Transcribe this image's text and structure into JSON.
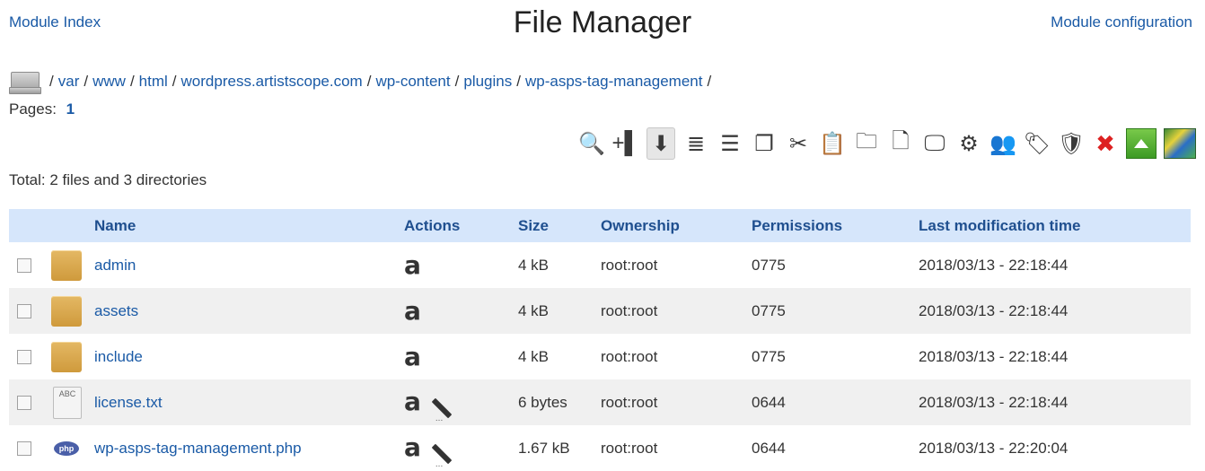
{
  "header": {
    "module_index": "Module Index",
    "title": "File Manager",
    "module_config": "Module configuration"
  },
  "breadcrumb": {
    "root_icon": "drive-icon",
    "leading_sep": "/",
    "items": [
      "var",
      "www",
      "html",
      "wordpress.artistscope.com",
      "wp-content",
      "plugins",
      "wp-asps-tag-management"
    ],
    "trailing_sep": "/"
  },
  "pagination": {
    "label": "Pages:",
    "current": "1"
  },
  "toolbar": [
    {
      "name": "search-icon",
      "glyph": "🔍"
    },
    {
      "name": "add-column-icon",
      "glyph": "+▌"
    },
    {
      "name": "sort-down-icon",
      "glyph": "⬇"
    },
    {
      "name": "list-view-icon",
      "glyph": "≣"
    },
    {
      "name": "detail-list-icon",
      "glyph": "☰"
    },
    {
      "name": "copy-icon",
      "glyph": "❐"
    },
    {
      "name": "cut-icon",
      "glyph": "✂"
    },
    {
      "name": "paste-icon",
      "glyph": "📋"
    },
    {
      "name": "new-folder-icon",
      "glyph": "🗀"
    },
    {
      "name": "new-file-icon",
      "glyph": "🗋"
    },
    {
      "name": "upload-icon",
      "glyph": "🖵"
    },
    {
      "name": "settings-icon",
      "glyph": "⚙"
    },
    {
      "name": "users-icon",
      "glyph": "👥"
    },
    {
      "name": "tag-icon",
      "glyph": "🏷"
    },
    {
      "name": "shield-icon",
      "glyph": "🛡"
    },
    {
      "name": "delete-icon",
      "glyph": "✖"
    },
    {
      "name": "upload-arrow-icon",
      "glyph": ""
    },
    {
      "name": "image-icon",
      "glyph": ""
    }
  ],
  "summary": "Total: 2 files and 3 directories",
  "table": {
    "headers": {
      "name": "Name",
      "actions": "Actions",
      "size": "Size",
      "ownership": "Ownership",
      "permissions": "Permissions",
      "mtime": "Last modification time"
    },
    "rows": [
      {
        "icon": "folder",
        "name": "admin",
        "actions": [
          "a"
        ],
        "size": "4 kB",
        "ownership": "root:root",
        "permissions": "0775",
        "mtime": "2018/03/13 - 22:18:44"
      },
      {
        "icon": "folder",
        "name": "assets",
        "actions": [
          "a"
        ],
        "size": "4 kB",
        "ownership": "root:root",
        "permissions": "0775",
        "mtime": "2018/03/13 - 22:18:44"
      },
      {
        "icon": "folder",
        "name": "include",
        "actions": [
          "a"
        ],
        "size": "4 kB",
        "ownership": "root:root",
        "permissions": "0775",
        "mtime": "2018/03/13 - 22:18:44"
      },
      {
        "icon": "text",
        "name": "license.txt",
        "actions": [
          "a",
          "edit"
        ],
        "size": "6 bytes",
        "ownership": "root:root",
        "permissions": "0644",
        "mtime": "2018/03/13 - 22:18:44"
      },
      {
        "icon": "php",
        "name": "wp-asps-tag-management.php",
        "actions": [
          "a",
          "edit"
        ],
        "size": "1.67 kB",
        "ownership": "root:root",
        "permissions": "0644",
        "mtime": "2018/03/13 - 22:20:04"
      }
    ]
  },
  "icon_labels": {
    "text": "ABC",
    "php": "php"
  }
}
